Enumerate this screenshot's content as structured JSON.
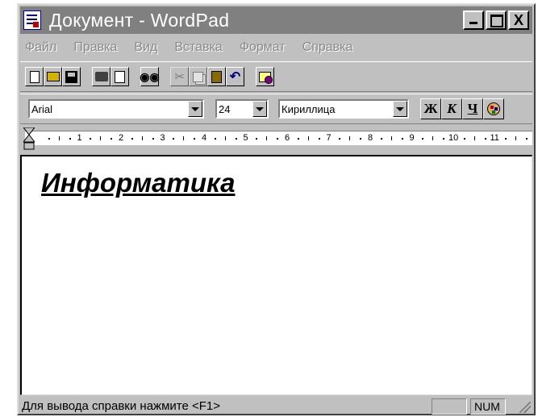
{
  "window": {
    "title": "Документ - WordPad",
    "minimize_label": "_",
    "close_label": "X"
  },
  "menu": {
    "items": [
      "Файл",
      "Правка",
      "Вид",
      "Вставка",
      "Формат",
      "Справка"
    ]
  },
  "toolbar": {
    "icons": [
      "new-document-icon",
      "open-folder-icon",
      "save-disk-icon",
      "print-icon",
      "print-preview-icon",
      "find-binoculars-icon",
      "cut-scissors-icon",
      "copy-icon",
      "paste-icon",
      "undo-icon",
      "date-time-icon"
    ]
  },
  "format": {
    "font": "Arial",
    "size": "24",
    "script": "Кириллица",
    "bold_label": "Ж",
    "italic_label": "К",
    "underline_label": "Ч"
  },
  "ruler": {
    "numbers": [
      "1",
      "2",
      "3",
      "4",
      "5",
      "6",
      "7",
      "8",
      "9",
      "10",
      "11"
    ]
  },
  "document": {
    "text": "Информатика"
  },
  "status": {
    "help_text": "Для вывода справки нажмите <F1>",
    "num_indicator": "NUM"
  },
  "colors": {
    "face": "#c0c0c0",
    "inactive_title": "#808080",
    "document_bg": "#ffffff"
  }
}
